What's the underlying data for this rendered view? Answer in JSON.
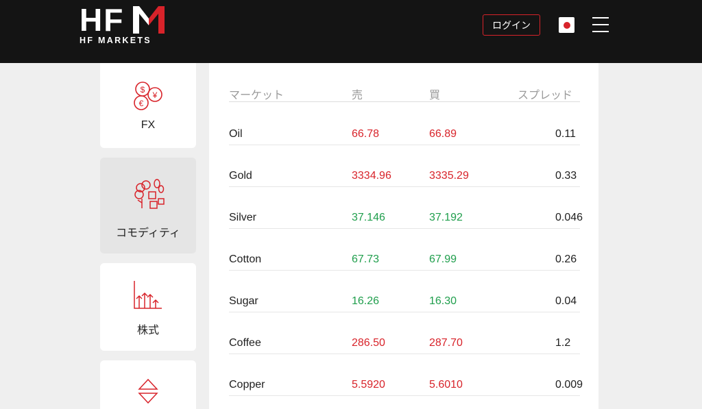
{
  "header": {
    "logo_letters": "HF",
    "logo_subtitle": "HF MARKETS",
    "login_label": "ログイン",
    "language_flag": "japan-flag-icon",
    "menu_icon": "hamburger-menu-icon",
    "colors": {
      "background": "#141414",
      "accent": "#d8232a"
    }
  },
  "sidebar": {
    "items": [
      {
        "label": "FX",
        "icon": "currency-coins-icon",
        "active": false
      },
      {
        "label": "コモディティ",
        "icon": "commodities-icon",
        "active": true
      },
      {
        "label": "株式",
        "icon": "stock-chart-icon",
        "active": false
      },
      {
        "label": "",
        "icon": "up-down-triangles-icon",
        "active": false
      }
    ]
  },
  "table": {
    "headers": {
      "market": "マーケット",
      "sell": "売",
      "buy": "買",
      "spread": "スプレッド"
    },
    "rows": [
      {
        "market": "Oil",
        "sell": "66.78",
        "buy": "66.89",
        "spread": "0.11",
        "trend": "down"
      },
      {
        "market": "Gold",
        "sell": "3334.96",
        "buy": "3335.29",
        "spread": "0.33",
        "trend": "down"
      },
      {
        "market": "Silver",
        "sell": "37.146",
        "buy": "37.192",
        "spread": "0.046",
        "trend": "up"
      },
      {
        "market": "Cotton",
        "sell": "67.73",
        "buy": "67.99",
        "spread": "0.26",
        "trend": "up"
      },
      {
        "market": "Sugar",
        "sell": "16.26",
        "buy": "16.30",
        "spread": "0.04",
        "trend": "up"
      },
      {
        "market": "Coffee",
        "sell": "286.50",
        "buy": "287.70",
        "spread": "1.2",
        "trend": "down"
      },
      {
        "market": "Copper",
        "sell": "5.5920",
        "buy": "5.6010",
        "spread": "0.009",
        "trend": "down"
      }
    ],
    "colors": {
      "up": "#1f9e4c",
      "down": "#d8232a"
    }
  }
}
